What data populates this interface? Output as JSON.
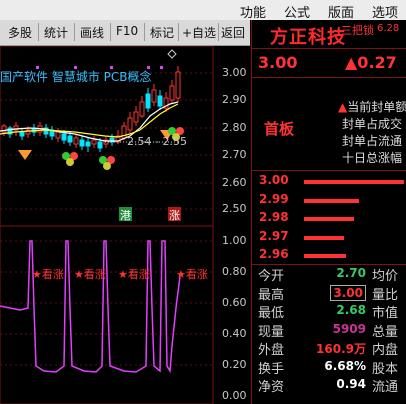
{
  "menubar": {
    "items": [
      "功能",
      "公式",
      "版面",
      "选项"
    ]
  },
  "toolbar": {
    "items": [
      "多股",
      "统计",
      "画线",
      "F10",
      "标记",
      "+自选",
      "返回"
    ]
  },
  "chart": {
    "overlay_text": "国产软件 智慧城市 PCB概念",
    "price_axis": [
      "3.00",
      "2.90",
      "2.80",
      "2.70",
      "2.60",
      "2.50",
      "2.40"
    ],
    "range_label": "2.54 - 2.55",
    "badge_left": "港",
    "badge_right": "涨",
    "indicator_axis": [
      "1.00",
      "0.80",
      "0.60",
      "0.40",
      "0.20",
      "0.00"
    ],
    "signal_label": "★看涨",
    "colors": {
      "up": "#ff3333",
      "down": "#00e5ff",
      "ma_white": "#ffffff",
      "ma_yellow": "#ffff33",
      "indicator": "#e040fb"
    }
  },
  "stock": {
    "name": "方正科技",
    "tag": "三把锁",
    "tag_value": "6.28",
    "price": "3.00",
    "change": "▲0.27",
    "status": "首板",
    "info_lines": [
      "当前封单额",
      "封单占成交",
      "封单占流通",
      "十日总涨幅"
    ]
  },
  "order_book": [
    {
      "price": "3.00",
      "bar": 1.0
    },
    {
      "price": "2.99",
      "bar": 0.55
    },
    {
      "price": "2.98",
      "bar": 0.5
    },
    {
      "price": "2.97",
      "bar": 0.4
    },
    {
      "price": "2.96",
      "bar": 0.42
    }
  ],
  "quote": {
    "rows": [
      {
        "label": "今开",
        "value": "2.70",
        "label2": "均价"
      },
      {
        "label": "最高",
        "value": "3.00",
        "label2": "量比"
      },
      {
        "label": "最低",
        "value": "2.68",
        "label2": "市值"
      },
      {
        "label": "现量",
        "value": "5909",
        "label2": "总量"
      },
      {
        "label": "外盘",
        "value": "160.9万",
        "label2": "内盘"
      },
      {
        "label": "换手",
        "value": "6.68%",
        "label2": "股本"
      },
      {
        "label": "净资",
        "value": "0.94",
        "label2": "流通"
      }
    ]
  }
}
